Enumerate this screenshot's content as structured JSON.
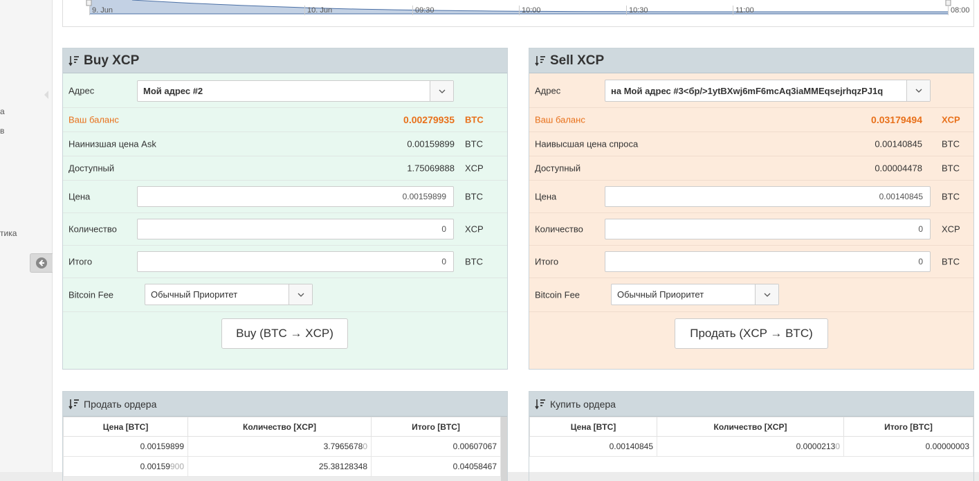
{
  "sidebar": {
    "fragments": [
      "а",
      "в",
      "тика"
    ],
    "collapse_icon": "circle-arrow-left-icon"
  },
  "chart_strip": {
    "ticks": [
      "9. Jun",
      "10. Jun",
      "09:30",
      "10:00",
      "10:30",
      "11:00",
      "08:00"
    ]
  },
  "buy": {
    "title": "Buy XCP",
    "address_label": "Адрес",
    "address_value": "Мой адрес #2",
    "balance_label": "Ваш баланс",
    "balance_value": "0.00279935",
    "balance_unit": "BTC",
    "best_label": "Наинизшая цена Ask",
    "best_value": "0.00159899",
    "best_unit": "BTC",
    "avail_label": "Доступный",
    "avail_value": "1.75069888",
    "avail_unit": "XCP",
    "price_label": "Цена",
    "price_value": "0.00159899",
    "price_unit": "BTC",
    "qty_label": "Количество",
    "qty_value": "0",
    "qty_unit": "XCP",
    "total_label": "Итого",
    "total_value": "0",
    "total_unit": "BTC",
    "fee_label": "Bitcoin Fee",
    "fee_value": "Обычный Приоритет",
    "button_label": "Buy (BTC → XCP)"
  },
  "sell": {
    "title": "Sell XCP",
    "address_label": "Адрес",
    "address_value": "на Мой адрес #3<бр/>1ytBXwj6mF6mcAq3iaMMEqsejrhqzPJ1q",
    "balance_label": "Ваш баланс",
    "balance_value": "0.03179494",
    "balance_unit": "XCP",
    "best_label": "Наивысшая цена спроса",
    "best_value": "0.00140845",
    "best_unit": "BTC",
    "avail_label": "Доступный",
    "avail_value": "0.00004478",
    "avail_unit": "BTC",
    "price_label": "Цена",
    "price_value": "0.00140845",
    "price_unit": "BTC",
    "qty_label": "Количество",
    "qty_value": "0",
    "qty_unit": "XCP",
    "total_label": "Итого",
    "total_value": "0",
    "total_unit": "BTC",
    "fee_label": "Bitcoin Fee",
    "fee_value": "Обычный Приоритет",
    "button_label": "Продать (XCP → BTC)"
  },
  "sell_orders": {
    "title": "Продать ордера",
    "headers": [
      "Цена [BTC]",
      "Количество [XCP]",
      "Итого [BTC]"
    ],
    "rows": [
      [
        [
          "0.00159899",
          ""
        ],
        [
          "3.7965678",
          "0"
        ],
        [
          "0.00607067",
          ""
        ]
      ],
      [
        [
          "0.00159",
          "900"
        ],
        [
          "25.38128348",
          ""
        ],
        [
          "0.04058467",
          ""
        ]
      ]
    ]
  },
  "buy_orders": {
    "title": "Купить ордера",
    "headers": [
      "Цена [BTC]",
      "Количество [XCP]",
      "Итого [BTC]"
    ],
    "rows": [
      [
        [
          "0.00140845",
          ""
        ],
        [
          "0.0000213",
          "0"
        ],
        [
          "0.00000003",
          ""
        ]
      ]
    ]
  }
}
